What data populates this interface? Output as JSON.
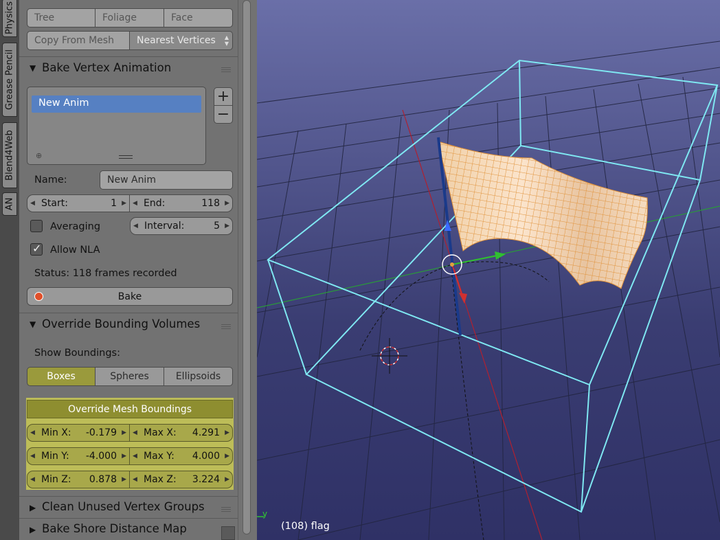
{
  "tabs": [
    "Physics",
    "Grease Pencil",
    "Blend4Web",
    "AN"
  ],
  "top_segment": [
    "Tree",
    "Foliage",
    "Face"
  ],
  "copy_from_mesh": "Copy From Mesh",
  "nearest_vertices": "Nearest Vertices",
  "bake_vertex_animation": {
    "header": "Bake Vertex Animation",
    "list_items": [
      "New Anim"
    ],
    "name_label": "Name:",
    "name_value": "New Anim",
    "start_label": "Start:",
    "start_value": "1",
    "end_label": "End:",
    "end_value": "118",
    "averaging_label": "Averaging",
    "averaging_checked": false,
    "interval_label": "Interval:",
    "interval_value": "5",
    "allow_nla_label": "Allow NLA",
    "allow_nla_checked": true,
    "status": "Status: 118 frames recorded",
    "bake_label": "Bake"
  },
  "override_bounding_volumes": {
    "header": "Override Bounding Volumes",
    "show_label": "Show Boundings:",
    "options": [
      "Boxes",
      "Spheres",
      "Ellipsoids"
    ],
    "selected": "Boxes",
    "override_mesh_label": "Override Mesh Boundings",
    "min_x_label": "Min X:",
    "min_x": "-0.179",
    "max_x_label": "Max X:",
    "max_x": "4.291",
    "min_y_label": "Min Y:",
    "min_y": "-4.000",
    "max_y_label": "Max Y:",
    "max_y": "4.000",
    "min_z_label": "Min Z:",
    "min_z": "0.878",
    "max_z_label": "Max Z:",
    "max_z": "3.224"
  },
  "collapsed_panels": [
    "Clean Unused Vertex Groups",
    "Bake Shore Distance Map"
  ],
  "viewport": {
    "object_label": "(108) flag",
    "axis_label": "y"
  },
  "colors": {
    "accent_blue": "#5680c2",
    "highlight_yellow": "#9a9a3c",
    "bounding_box": "#7fe8f2",
    "mesh_wire": "#e0923a"
  }
}
